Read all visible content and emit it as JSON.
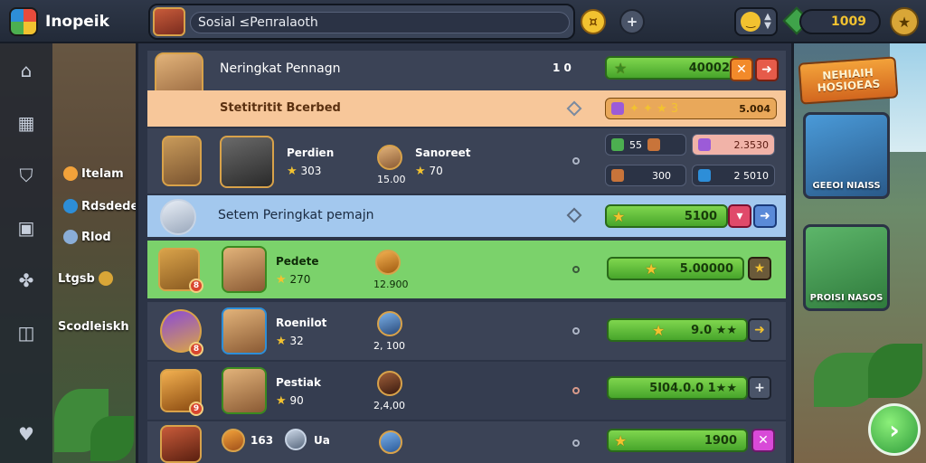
{
  "brand": {
    "name": "Inopeik"
  },
  "search": {
    "value": "Sosial ≤Peпralaoth"
  },
  "currency": {
    "amount": "1009"
  },
  "sidebar": {
    "labels": [
      {
        "text": "Itelam",
        "color": "#f2a23a"
      },
      {
        "text": "Rdsdedes",
        "color": "#2d8ed8"
      },
      {
        "text": "Rlod",
        "color": "#8aaed8"
      },
      {
        "text": "Ltgsb",
        "color": "#d9a637"
      },
      {
        "text": "Scodleiskh",
        "color": ""
      }
    ]
  },
  "header_row": {
    "title": "Neringkat Pennagn",
    "count": "1 0",
    "bar_value": "40002"
  },
  "highlight_row": {
    "label": "Stetitritit Bcerbed",
    "value": "5.004"
  },
  "player_rows": [
    {
      "name": "Perdien",
      "rating": "303",
      "rival_name": "Sanoreet",
      "rival_rating": "70",
      "rival_score": "15.00",
      "resources": [
        {
          "count": "55",
          "color": "#4caf50"
        },
        {
          "count": "2.3530",
          "color": "#9c5bd8"
        },
        {
          "count": "300",
          "color": "#c8743a"
        },
        {
          "count": "2 5010",
          "color": "#2d8ed8"
        }
      ]
    }
  ],
  "system_row": {
    "title": "Setem Peringkat pemajn",
    "bar_value": "5100"
  },
  "list_rows": [
    {
      "name": "Pedete",
      "rating": "270",
      "score": "12.900",
      "bar_value": "5.00000",
      "badge": "8"
    },
    {
      "name": "Roenilot",
      "rating": "32",
      "score": "2, 100",
      "bar_value": "9.0 ★★",
      "badge": "8"
    },
    {
      "name": "Pestiak",
      "rating": "90",
      "score": "2,4,00",
      "bar_value": "5I04.0.0 1★★",
      "badge": "9"
    },
    {
      "name": "Ua",
      "rating": "163",
      "score": "",
      "bar_value": "1900",
      "badge": ""
    }
  ],
  "cards": [
    {
      "label": "GEEOI NIAISS"
    },
    {
      "label": "PROISI NASOS"
    }
  ],
  "promo": {
    "text": "NEHIAIH HOSIOEAS"
  },
  "colors": {
    "green": "#47a52b",
    "gold": "#f2c230",
    "panel": "#2c3446",
    "highlight": "#f7c79a",
    "system": "#a3c8ee",
    "selected": "#7bd26b"
  }
}
